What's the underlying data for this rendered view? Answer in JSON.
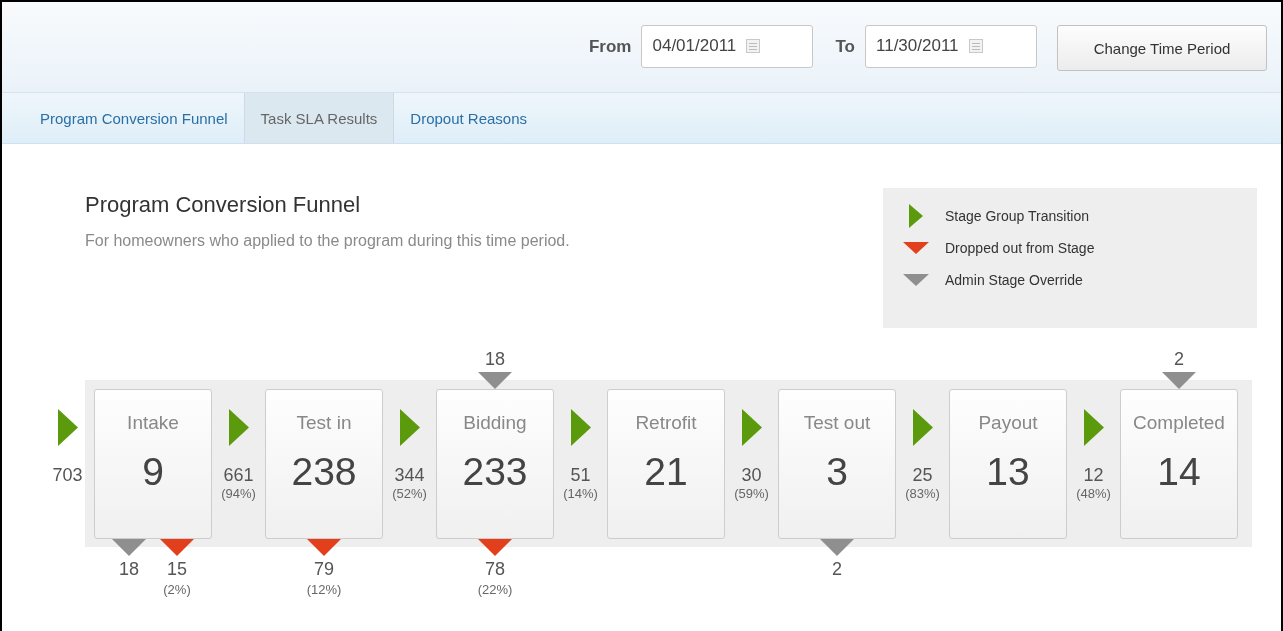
{
  "header": {
    "from_label": "From",
    "from_date": "04/01/2011",
    "to_label": "To",
    "to_date": "11/30/2011",
    "button": "Change Time Period"
  },
  "tabs": [
    {
      "label": "Program Conversion Funnel",
      "selected": false
    },
    {
      "label": "Task SLA Results",
      "selected": true
    },
    {
      "label": "Dropout Reasons",
      "selected": false
    }
  ],
  "funnel": {
    "title": "Program Conversion Funnel",
    "subtitle": "For homeowners who applied to the program during this time period.",
    "legend": [
      {
        "kind": "transition",
        "label": "Stage Group Transition"
      },
      {
        "kind": "dropout",
        "label": "Dropped out from Stage"
      },
      {
        "kind": "override",
        "label": "Admin Stage Override"
      }
    ],
    "stages": [
      {
        "name": "Intake",
        "count": "9",
        "incoming": {
          "count": "703"
        },
        "bottom": [
          {
            "kind": "override",
            "count": "18"
          },
          {
            "kind": "dropout",
            "count": "15",
            "percent": "(2%)"
          }
        ]
      },
      {
        "name": "Test in",
        "count": "238",
        "incoming": {
          "count": "661",
          "percent": "(94%)"
        },
        "bottom": [
          {
            "kind": "dropout",
            "count": "79",
            "percent": "(12%)"
          }
        ]
      },
      {
        "name": "Bidding",
        "count": "233",
        "incoming": {
          "count": "344",
          "percent": "(52%)"
        },
        "top": [
          {
            "kind": "override",
            "count": "18"
          }
        ],
        "bottom": [
          {
            "kind": "dropout",
            "count": "78",
            "percent": "(22%)"
          }
        ]
      },
      {
        "name": "Retrofit",
        "count": "21",
        "incoming": {
          "count": "51",
          "percent": "(14%)"
        }
      },
      {
        "name": "Test out",
        "count": "3",
        "incoming": {
          "count": "30",
          "percent": "(59%)"
        },
        "bottom": [
          {
            "kind": "override",
            "count": "2"
          }
        ]
      },
      {
        "name": "Payout",
        "count": "13",
        "incoming": {
          "count": "25",
          "percent": "(83%)"
        }
      },
      {
        "name": "Completed",
        "count": "14",
        "incoming": {
          "count": "12",
          "percent": "(48%)"
        },
        "top": [
          {
            "kind": "override",
            "count": "2"
          }
        ]
      }
    ]
  }
}
